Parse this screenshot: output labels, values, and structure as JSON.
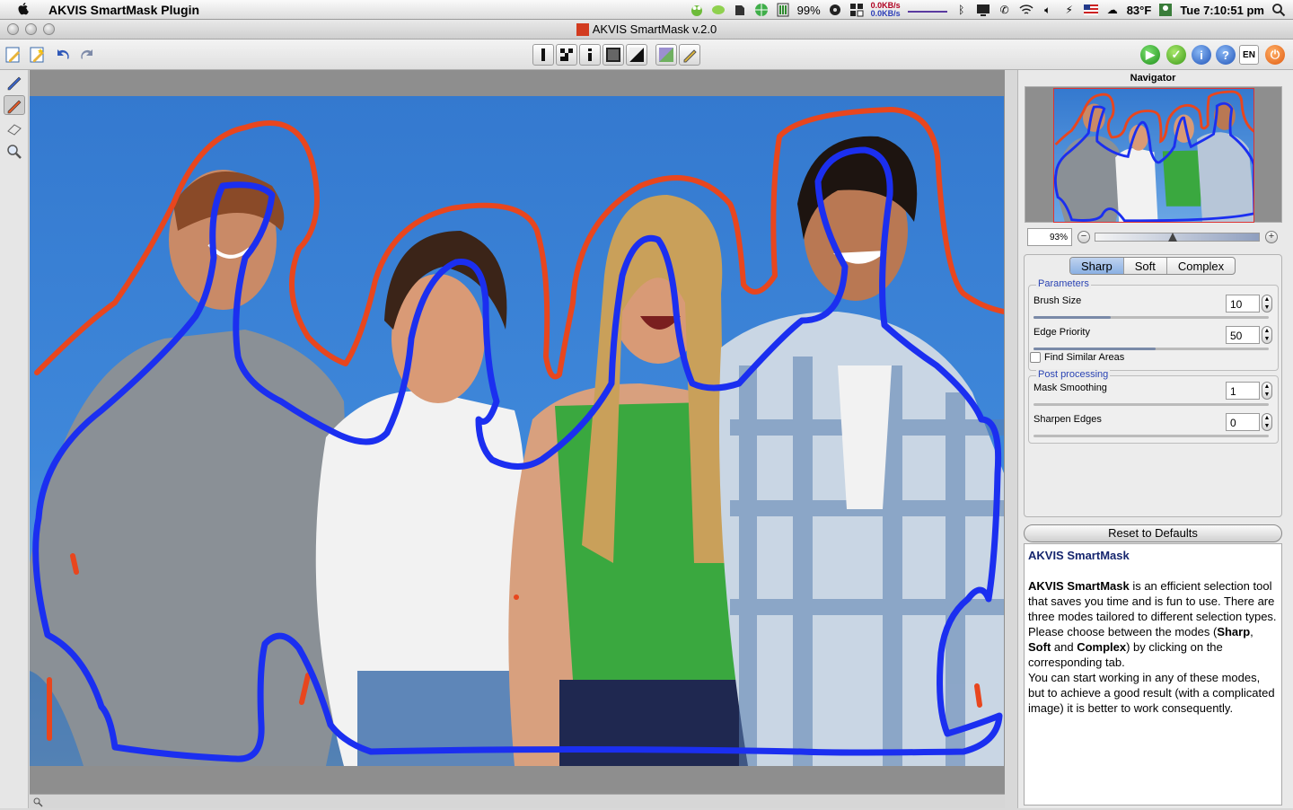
{
  "menubar": {
    "app_name": "AKVIS SmartMask Plugin",
    "battery": "99%",
    "net_up": "0.0KB/s",
    "net_down": "0.0KB/s",
    "temperature": "83°F",
    "clock": "Tue 7:10:51 pm"
  },
  "window": {
    "title": "AKVIS SmartMask v.2.0"
  },
  "toolbar": {
    "lang": "EN"
  },
  "navigator": {
    "title": "Navigator",
    "zoom": "93%",
    "zoom_level": 0.47
  },
  "tabs": [
    {
      "label": "Sharp",
      "active": true
    },
    {
      "label": "Soft",
      "active": false
    },
    {
      "label": "Complex",
      "active": false
    }
  ],
  "parameters": {
    "title": "Parameters",
    "brush_size": {
      "label": "Brush Size",
      "value": "10",
      "level": 0.33
    },
    "edge_priority": {
      "label": "Edge Priority",
      "value": "50",
      "level": 0.52
    },
    "find_similar": {
      "label": "Find Similar Areas",
      "checked": false
    }
  },
  "post_processing": {
    "title": "Post processing",
    "mask_smoothing": {
      "label": "Mask Smoothing",
      "value": "1",
      "level": 0.0
    },
    "sharpen_edges": {
      "label": "Sharpen Edges",
      "value": "0",
      "level": 0.0
    }
  },
  "reset_label": "Reset to Defaults",
  "help": {
    "title": "AKVIS SmartMask",
    "product": "AKVIS SmartMask",
    "p1_rest": " is an efficient selection tool that saves you time and is fun to use. There are three modes tailored to different selection types. Please choose between the modes (",
    "m1": "Sharp",
    "sep1": ", ",
    "m2": "Soft",
    "sep2": " and ",
    "m3": "Complex",
    "p1_end": ") by clicking on the corresponding tab.",
    "p2": "You can start working in any of these modes, but to achieve a good result (with a complicated image) it is better to work consequently."
  },
  "colors": {
    "red_stroke": "#e8461e",
    "blue_stroke": "#1b2ff0",
    "sky": "#3a80d4"
  }
}
